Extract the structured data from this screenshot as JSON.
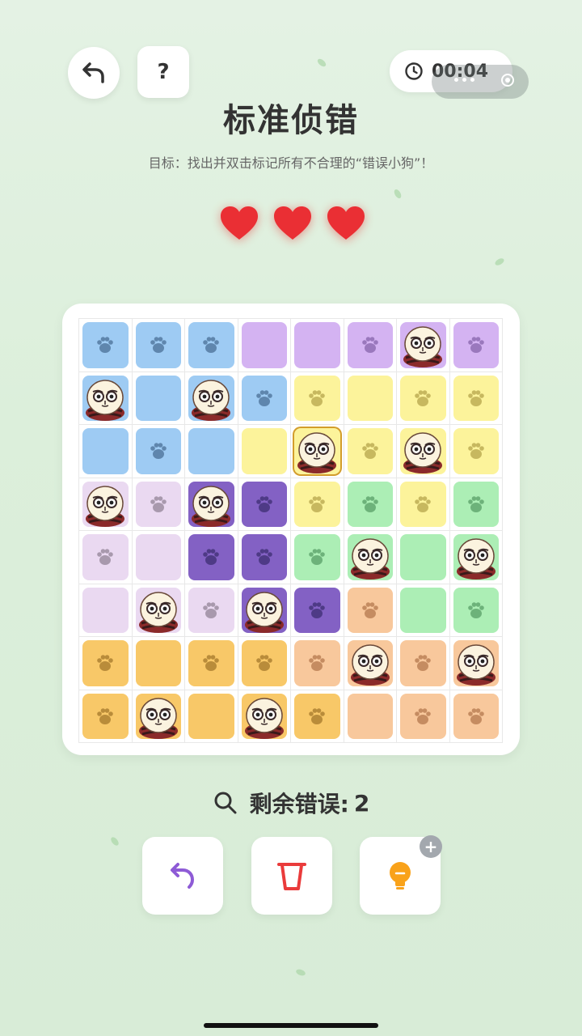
{
  "header": {
    "back_icon": "undo-arrow-icon",
    "help_label": "?",
    "timer": "00:04",
    "title": "标准侦错",
    "subtitle": "目标：找出并双击标记所有不合理的“错误小狗”！"
  },
  "lives": {
    "hearts": 3,
    "color": "#ea2f34"
  },
  "colors": {
    "blue": "#9ecbf3",
    "purple": "#d4b3f2",
    "yellow": "#fcf39b",
    "lavender": "#ead9f1",
    "violet": "#8361c4",
    "green": "#aceeb5",
    "peach": "#f8c89c",
    "orange": "#f8c868"
  },
  "board": {
    "rows": [
      [
        "blue:paw",
        "blue:paw",
        "blue:paw",
        "purple:empty",
        "purple:empty",
        "purple:paw",
        "purple:dog",
        "purple:paw"
      ],
      [
        "blue:dog",
        "blue:empty",
        "blue:dog",
        "blue:paw",
        "yellow:paw",
        "yellow:empty",
        "yellow:paw",
        "yellow:paw"
      ],
      [
        "blue:empty",
        "blue:paw",
        "blue:empty",
        "yellow:empty",
        "yellow:dog-selected",
        "yellow:paw",
        "yellow:dog",
        "yellow:paw"
      ],
      [
        "lavender:dog",
        "lavender:paw",
        "violet:dog",
        "violet:paw",
        "yellow:paw",
        "green:paw",
        "yellow:paw",
        "green:paw"
      ],
      [
        "lavender:paw",
        "lavender:empty",
        "violet:paw",
        "violet:paw",
        "green:paw",
        "green:dog",
        "green:empty",
        "green:dog"
      ],
      [
        "lavender:empty",
        "lavender:dog",
        "lavender:paw",
        "violet:dog",
        "violet:paw",
        "peach:paw",
        "green:empty",
        "green:paw"
      ],
      [
        "orange:paw",
        "orange:empty",
        "orange:paw",
        "orange:paw",
        "peach:paw",
        "peach:dog",
        "peach:paw",
        "peach:dog"
      ],
      [
        "orange:paw",
        "orange:dog",
        "orange:empty",
        "orange:dog",
        "orange:paw",
        "peach:empty",
        "peach:paw",
        "peach:paw"
      ]
    ]
  },
  "status": {
    "label": "剩余错误:",
    "count": "2"
  },
  "toolbar": {
    "undo_icon": "undo-icon",
    "clear_icon": "cup-icon",
    "hint_icon": "lightbulb-icon",
    "hint_badge": "+"
  }
}
